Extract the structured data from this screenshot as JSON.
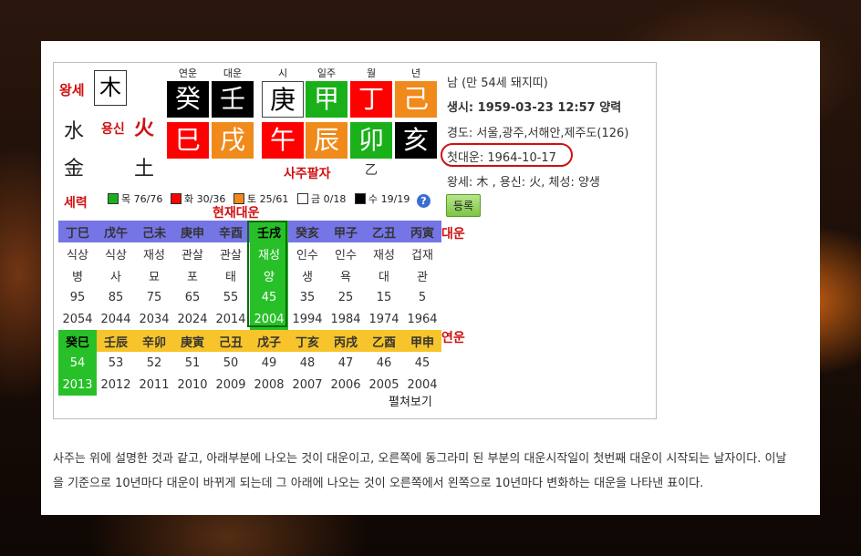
{
  "left": {
    "wangse_label": "왕세",
    "wangse_value": "木",
    "yongsin_label": "용신",
    "yongsin_value": "火",
    "elements": [
      "水",
      "金",
      "土"
    ]
  },
  "pillars": {
    "headers": [
      "연운",
      "대운",
      "시",
      "일주",
      "월",
      "년"
    ],
    "top": [
      "癸",
      "壬",
      "庚",
      "甲",
      "丁",
      "己"
    ],
    "bottom": [
      "巳",
      "戌",
      "午",
      "辰",
      "卯",
      "亥"
    ],
    "top_colors": [
      "black",
      "black",
      "white",
      "green",
      "red",
      "orange"
    ],
    "bottom_colors": [
      "red",
      "orange",
      "red",
      "orange",
      "green",
      "black"
    ],
    "saju_label": "사주팔자",
    "extra": "乙"
  },
  "info": {
    "line1": "남 (만 54세 돼지띠)",
    "line2": "생시: 1959-03-23 12:57 양력",
    "line3": "경도: 서울,광주,서해안,제주도(126)",
    "line4": "첫대운: 1964-10-17",
    "line5": "왕세: 木 , 용신: 火, 체성: 양생",
    "register_button": "등록"
  },
  "legend": {
    "title": "세력",
    "items": [
      {
        "label": "목 76/76",
        "color": "#1ab01a"
      },
      {
        "label": "화 30/36",
        "color": "#ff0000"
      },
      {
        "label": "토 25/61",
        "color": "#f08a1a"
      },
      {
        "label": "금 0/18",
        "color": "#ffffff"
      },
      {
        "label": "수 19/19",
        "color": "#000000"
      }
    ],
    "help": "?"
  },
  "daeun": {
    "current_label": "현재대운",
    "side_label": "대운",
    "pillars": [
      "丁巳",
      "戊午",
      "己未",
      "庚申",
      "辛酉",
      "壬戌",
      "癸亥",
      "甲子",
      "乙丑",
      "丙寅"
    ],
    "sipsin": [
      "식상",
      "식상",
      "재성",
      "관살",
      "관살",
      "재성",
      "인수",
      "인수",
      "재성",
      "겁재"
    ],
    "stage": [
      "병",
      "사",
      "묘",
      "포",
      "태",
      "양",
      "생",
      "욕",
      "대",
      "관"
    ],
    "age": [
      "95",
      "85",
      "75",
      "65",
      "55",
      "45",
      "35",
      "25",
      "15",
      "5"
    ],
    "year": [
      "2054",
      "2044",
      "2034",
      "2024",
      "2014",
      "2004",
      "1994",
      "1984",
      "1974",
      "1964"
    ],
    "current_index": 5
  },
  "yeonun": {
    "side_label": "연운",
    "pillars": [
      "癸巳",
      "壬辰",
      "辛卯",
      "庚寅",
      "己丑",
      "戊子",
      "丁亥",
      "丙戌",
      "乙酉",
      "甲申"
    ],
    "age": [
      "54",
      "53",
      "52",
      "51",
      "50",
      "49",
      "48",
      "47",
      "46",
      "45"
    ],
    "year": [
      "2013",
      "2012",
      "2011",
      "2010",
      "2009",
      "2008",
      "2007",
      "2006",
      "2005",
      "2004"
    ],
    "current_index": 0,
    "expand_link": "펼쳐보기"
  },
  "paragraph": "사주는 위에 설명한 것과 같고, 아래부분에 나오는 것이 대운이고, 오른쪽에 동그라미 된 부분의 대운시작일이 첫번째 대운이 시작되는 날자이다. 이날을 기준으로 10년마다 대운이 바뀌게 되는데 그 아래에 나오는 것이 오른쪽에서 왼쪽으로 10년마다 변화하는 대운을 나타낸 표이다."
}
